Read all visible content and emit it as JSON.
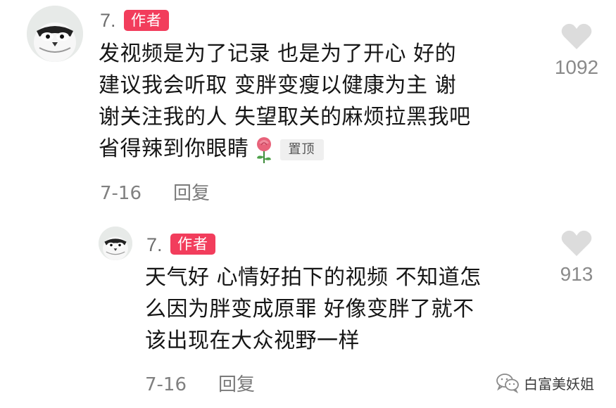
{
  "comments": [
    {
      "username": "7.",
      "badge": "作者",
      "lines": [
        "发视频是为了记录 也是为了开心 好的",
        "建议我会听取 变胖变瘦以健康为主 谢",
        "谢关注我的人 失望取关的麻烦拉黑我吧",
        "省得辣到你眼睛"
      ],
      "emoji": "rose",
      "pinned_label": "置顶",
      "date": "7-16",
      "reply_label": "回复",
      "likes": "1092"
    },
    {
      "username": "7.",
      "badge": "作者",
      "lines": [
        "天气好 心情好拍下的视频 不知道怎",
        "么因为胖变成原罪 好像变胖了就不",
        "该出现在大众视野一样"
      ],
      "date": "7-16",
      "reply_label": "回复",
      "likes": "913"
    }
  ],
  "watermark": {
    "text": "白富美妖姐",
    "icon": "wechat-icon"
  },
  "colors": {
    "badge": "#f23d5c",
    "meta": "#808080",
    "heart": "#dcdcdc"
  }
}
